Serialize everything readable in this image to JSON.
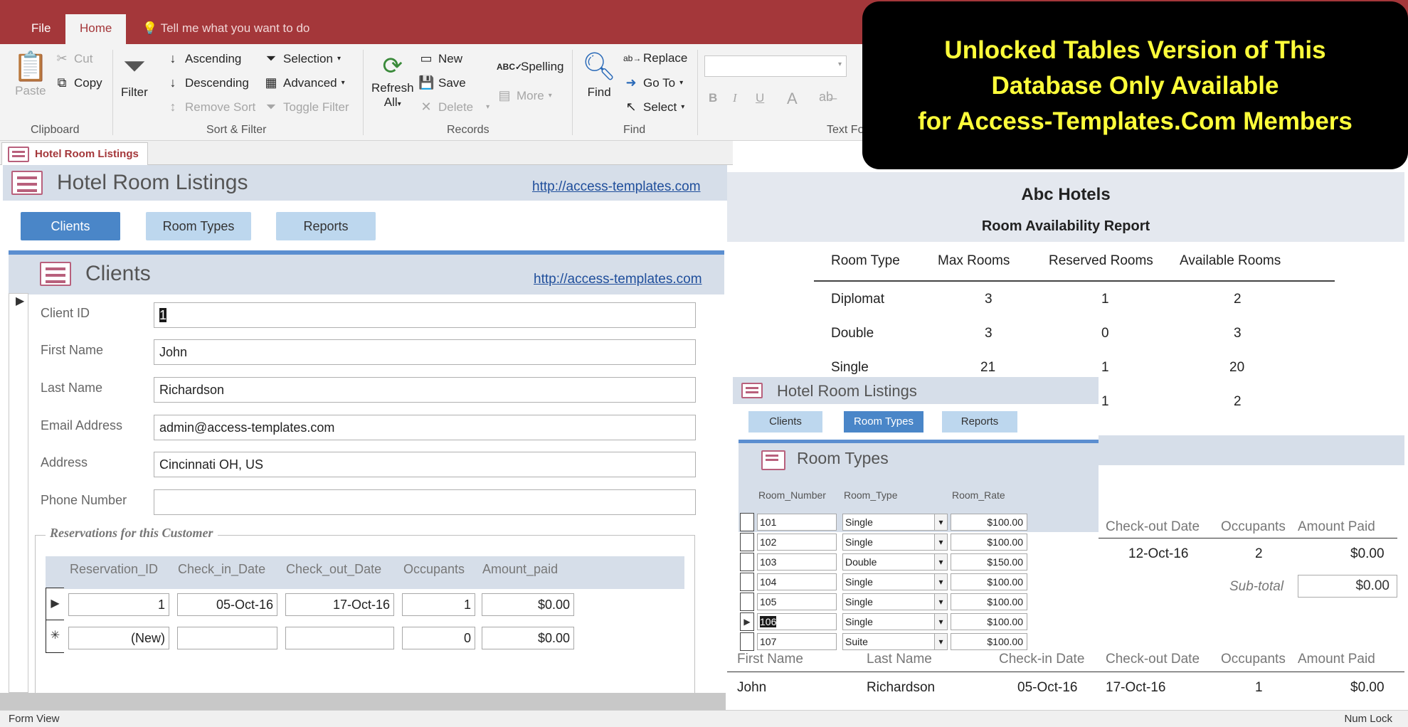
{
  "ribbon_tabs": {
    "file": "File",
    "home": "Home",
    "tell_me": "Tell me what you want to do"
  },
  "ribbon": {
    "paste": "Paste",
    "cut": "Cut",
    "copy": "Copy",
    "clipboard_group": "Clipboard",
    "filter": "Filter",
    "ascending": "Ascending",
    "descending": "Descending",
    "remove_sort": "Remove Sort",
    "selection": "Selection",
    "advanced": "Advanced",
    "toggle_filter": "Toggle Filter",
    "sort_group": "Sort & Filter",
    "refresh": "Refresh",
    "refresh_all": "All",
    "new": "New",
    "save": "Save",
    "delete": "Delete",
    "spelling": "Spelling",
    "more": "More",
    "records_group": "Records",
    "find": "Find",
    "replace": "Replace",
    "go_to": "Go To",
    "select": "Select",
    "find_group": "Find",
    "text_format_group": "Text Fo",
    "bold": "B",
    "italic": "I",
    "underline": "U",
    "font_color": "A"
  },
  "doc_tab": "Hotel Room Listings",
  "main_form": {
    "title": "Hotel Room Listings",
    "link": "http://access-templates.com",
    "nav": [
      "Clients",
      "Room Types",
      "Reports"
    ],
    "active_nav": "Clients",
    "subform_title": "Clients",
    "subform_link": "http://access-templates.com",
    "fields": {
      "client_id": {
        "label": "Client ID",
        "value": "1"
      },
      "first_name": {
        "label": "First Name",
        "value": "John"
      },
      "last_name": {
        "label": "Last Name",
        "value": "Richardson"
      },
      "email": {
        "label": "Email Address",
        "value": "admin@access-templates.com"
      },
      "address": {
        "label": "Address",
        "value": "Cincinnati OH, US"
      },
      "phone": {
        "label": "Phone Number",
        "value": ""
      }
    },
    "reservations": {
      "group_label": "Reservations for this Customer",
      "columns": [
        "Reservation_ID",
        "Check_in_Date",
        "Check_out_Date",
        "Occupants",
        "Amount_paid"
      ],
      "rows": [
        [
          "1",
          "05-Oct-16",
          "17-Oct-16",
          "1",
          "$0.00"
        ],
        [
          "(New)",
          "",
          "",
          "0",
          "$0.00"
        ]
      ]
    }
  },
  "report": {
    "company": "Abc Hotels",
    "title": "Room Availability Report",
    "columns": [
      "Room Type",
      "Max Rooms",
      "Reserved Rooms",
      "Available Rooms"
    ],
    "rows": [
      [
        "Diplomat",
        "3",
        "1",
        "2"
      ],
      [
        "Double",
        "3",
        "0",
        "3"
      ],
      [
        "Single",
        "21",
        "1",
        "20"
      ],
      [
        "",
        "",
        "1",
        "2"
      ]
    ],
    "detail_columns": [
      "Check-out Date",
      "Occupants",
      "Amount Paid"
    ],
    "detail_row": [
      "12-Oct-16",
      "2",
      "$0.00"
    ],
    "subtotal_label": "Sub-total",
    "subtotal_value": "$0.00",
    "bottom_columns": [
      "First Name",
      "Last Name",
      "Check-in Date",
      "Check-out Date",
      "Occupants",
      "Amount Paid"
    ],
    "bottom_row": [
      "John",
      "Richardson",
      "05-Oct-16",
      "17-Oct-16",
      "1",
      "$0.00"
    ]
  },
  "inset_form": {
    "title": "Hotel Room Listings",
    "nav": [
      "Clients",
      "Room Types",
      "Reports"
    ],
    "active_nav": "Room Types",
    "subform_title": "Room Types",
    "columns": [
      "Room_Number",
      "Room_Type",
      "Room_Rate"
    ],
    "rows": [
      [
        "101",
        "Single",
        "$100.00"
      ],
      [
        "102",
        "Single",
        "$100.00"
      ],
      [
        "103",
        "Double",
        "$150.00"
      ],
      [
        "104",
        "Single",
        "$100.00"
      ],
      [
        "105",
        "Single",
        "$100.00"
      ],
      [
        "106",
        "Single",
        "$100.00"
      ],
      [
        "107",
        "Suite",
        "$100.00"
      ]
    ],
    "selected_row": 5
  },
  "banner": {
    "line1": "Unlocked Tables Version of This",
    "line2": "Database Only Available",
    "line3": "for Access-Templates.Com Members"
  },
  "status": {
    "left": "Form View",
    "right": "Num Lock"
  },
  "colors": {
    "accent": "#a4373a",
    "nav_active": "#4a86c8",
    "nav_inactive": "#bdd7ee",
    "banner_text": "#ffff3a"
  }
}
